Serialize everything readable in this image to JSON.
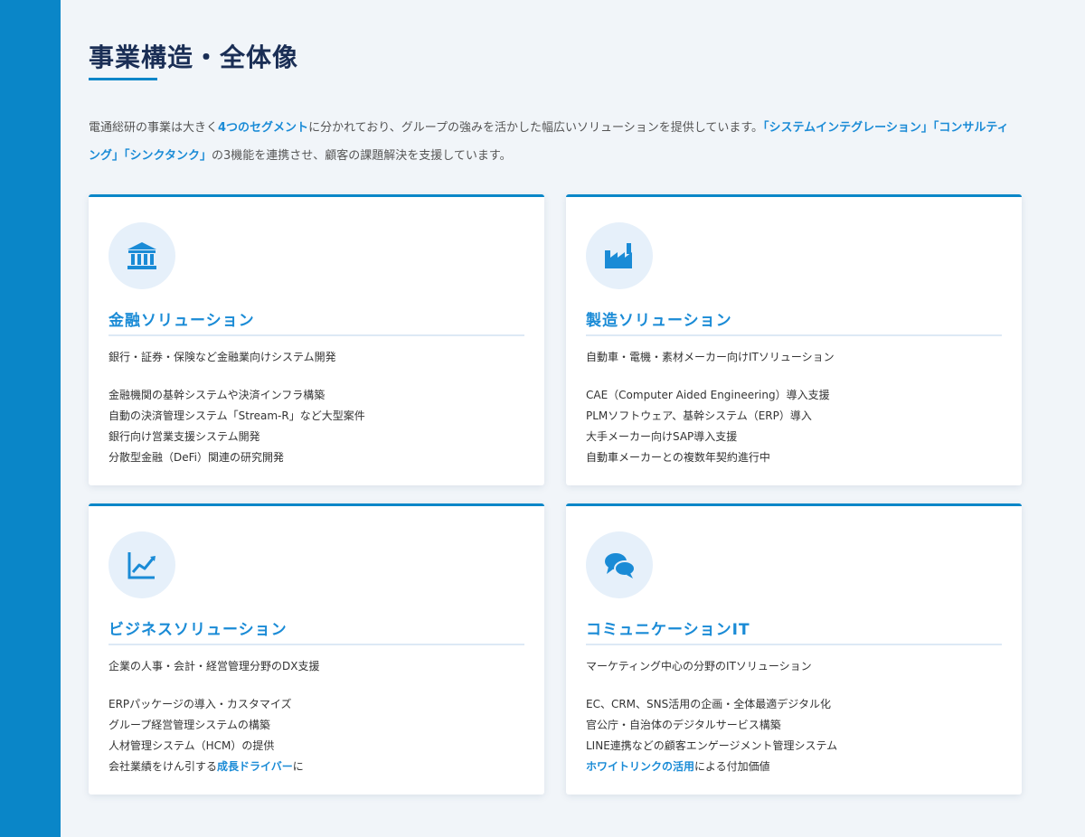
{
  "page": {
    "title": "事業構造・全体像",
    "intro": {
      "part1": "電通総研の事業は大きく",
      "segments": "4つのセグメント",
      "part2": "に分かれており、グループの強みを活かした幅広いソリューションを提供しています。",
      "functions": "「システムインテグレーション」「コンサルティング」「シンクタンク」",
      "part3": "の3機能を連携させ、顧客の課題解決を支援しています。"
    }
  },
  "colors": {
    "accent": "#0a86c8",
    "title": "#1a2e55",
    "highlight": "#1a8bd6",
    "icon_bg": "#e6f0fa",
    "background": "#f1f5f9"
  },
  "cards": [
    {
      "icon": "bank-icon",
      "title": "金融ソリューション",
      "lead": "銀行・証券・保険など金融業向けシステム開発",
      "items": [
        {
          "text": "金融機関の基幹システムや決済インフラ構築"
        },
        {
          "text": "自動の決済管理システム「Stream-R」など大型案件"
        },
        {
          "text": "銀行向け営業支援システム開発"
        },
        {
          "text": "分散型金融（DeFi）関連の研究開発"
        }
      ]
    },
    {
      "icon": "factory-icon",
      "title": "製造ソリューション",
      "lead": "自動車・電機・素材メーカー向けITソリューション",
      "items": [
        {
          "text": "CAE（Computer Aided Engineering）導入支援"
        },
        {
          "text": "PLMソフトウェア、基幹システム（ERP）導入"
        },
        {
          "text": "大手メーカー向けSAP導入支援"
        },
        {
          "text": "自動車メーカーとの複数年契約進行中"
        }
      ]
    },
    {
      "icon": "chart-icon",
      "title": "ビジネスソリューション",
      "lead": "企業の人事・会計・経営管理分野のDX支援",
      "items": [
        {
          "text": "ERPパッケージの導入・カスタマイズ"
        },
        {
          "text": "グループ経営管理システムの構築"
        },
        {
          "text": "人材管理システム（HCM）の提供"
        },
        {
          "pre": "会社業績をけん引する",
          "highlight": "成長ドライバー",
          "post": "に"
        }
      ]
    },
    {
      "icon": "chat-icon",
      "title": "コミュニケーションIT",
      "lead": "マーケティング中心の分野のITソリューション",
      "items": [
        {
          "text": "EC、CRM、SNS活用の企画・全体最適デジタル化"
        },
        {
          "text": "官公庁・自治体のデジタルサービス構築"
        },
        {
          "text": "LINE連携などの顧客エンゲージメント管理システム"
        },
        {
          "pre": "",
          "highlight": "ホワイトリンクの活用",
          "post": "による付加価値"
        }
      ]
    }
  ]
}
